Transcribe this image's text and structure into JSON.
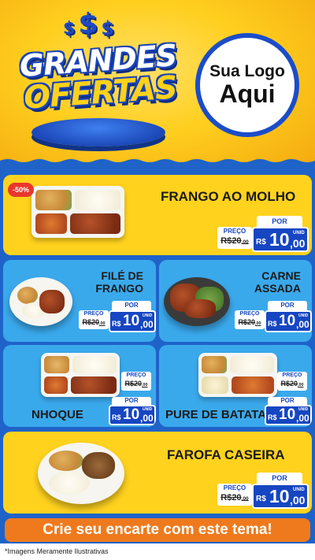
{
  "header": {
    "dollar_signs": [
      "$",
      "$",
      "$"
    ],
    "title_line1": "GRANDES",
    "title_line2": "OFERTAS",
    "logo_line1": "Sua Logo",
    "logo_line2": "Aqui"
  },
  "colors": {
    "header_yellow": "#ffd21e",
    "background_blue": "#1f63c9",
    "card_yellow": "#ffd21e",
    "card_blue": "#3aa9ec",
    "price_blue": "#1646c2",
    "badge_red": "#e8372b",
    "cta_orange": "#ef7a1d"
  },
  "price_labels": {
    "preco": "PREÇO",
    "por": "POR",
    "currency": "R$",
    "unit": "UNID"
  },
  "products": [
    {
      "name": "FRANGO AO MOLHO",
      "badge": "-50%",
      "old_price_int": "20",
      "old_price_dec": ",00",
      "price_int": "10",
      "price_dec": ",00",
      "image": "marmita-frango-molho"
    },
    {
      "name_line1": "FILÉ DE",
      "name_line2": "FRANGO",
      "old_price_int": "20",
      "old_price_dec": ",00",
      "price_int": "10",
      "price_dec": ",00",
      "image": "prato-file-frango"
    },
    {
      "name_line1": "CARNE",
      "name_line2": "ASSADA",
      "old_price_int": "20",
      "old_price_dec": ",00",
      "price_int": "10",
      "price_dec": ",00",
      "image": "prato-carne-assada"
    },
    {
      "name": "NHOQUE",
      "old_price_int": "20",
      "old_price_dec": ",00",
      "price_int": "10",
      "price_dec": ",00",
      "image": "marmita-nhoque"
    },
    {
      "name": "PURE DE BATATA",
      "old_price_int": "20",
      "old_price_dec": ",00",
      "price_int": "10",
      "price_dec": ",00",
      "image": "marmita-pure-batata"
    },
    {
      "name": "FAROFA CASEIRA",
      "old_price_int": "20",
      "old_price_dec": ",00",
      "price_int": "10",
      "price_dec": ",00",
      "image": "prato-farofa"
    }
  ],
  "cta_text": "Crie seu encarte com este tema!",
  "footer_note": "*Imagens Meramente Ilustrativas"
}
